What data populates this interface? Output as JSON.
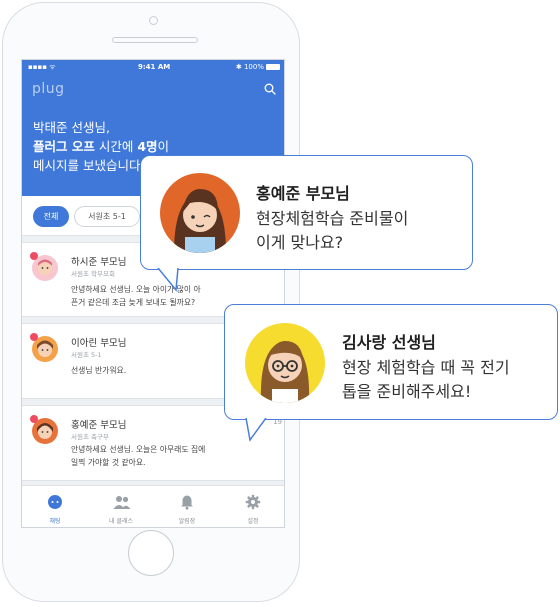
{
  "status_bar": {
    "signal": "▪▪▪▪ ᯤ",
    "time": "9:41 AM",
    "battery": "✱ 100%"
  },
  "app": {
    "logo": "plug"
  },
  "header": {
    "line1": "박태준 선생님,",
    "line2_bold": "플러그 오프",
    "line2_mid": " 시간에 ",
    "line2_count": "4명",
    "line2_end": "이",
    "line3": "메시지를 보냈습니다."
  },
  "filters": {
    "all": "전체",
    "class": "서원초 5-1"
  },
  "messages": [
    {
      "name": "하시준 부모님",
      "sub": "서원초 학부모회",
      "line1": "안녕하세요 선생님. 오늘 아이가 많이 아",
      "line2": "픈거 같은데 조금 늦게 보내도 될까요?",
      "date": ""
    },
    {
      "name": "이아린 부모님",
      "sub": "서원초 5-1",
      "line1": "선생님 반가워요.",
      "line2": "",
      "date": "19"
    },
    {
      "name": "홍예준 부모님",
      "sub": "서원초 축구부",
      "line1": "안녕하세요 선생님. 오늘은 아무래도 집에",
      "line2": "일찍 가야할 것 같아요.",
      "date": "19"
    }
  ],
  "tabs": [
    {
      "label": "채팅",
      "icon": "chat-icon"
    },
    {
      "label": "내 클래스",
      "icon": "people-icon"
    },
    {
      "label": "알림장",
      "icon": "bell-icon"
    },
    {
      "label": "설정",
      "icon": "gear-icon"
    }
  ],
  "bubbles": [
    {
      "name": "홍예준 부모님",
      "line1": "현장체험학습 준비물이",
      "line2": "이게 맞나요?"
    },
    {
      "name": "김사랑 선생님",
      "line1": "현장 체험학습 때 꼭 전기",
      "line2": "톱을 준비해주세요!"
    }
  ],
  "colors": {
    "accent": "#3f78d8",
    "badge": "#ef4b62",
    "bubble_border": "#4a7fd9"
  }
}
